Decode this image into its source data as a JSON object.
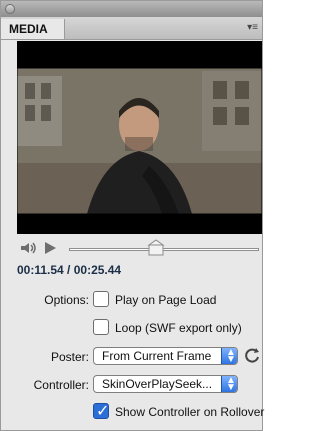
{
  "panel": {
    "tab_label": "MEDIA",
    "menu_icon": "panel-menu-icon"
  },
  "playback": {
    "current_time": "00:11.54",
    "separator": " / ",
    "duration": "00:25.44",
    "progress_fraction": 0.45,
    "icons": {
      "volume": "speaker-icon",
      "play": "play-icon",
      "refresh": "refresh-icon"
    }
  },
  "options": {
    "label": "Options:",
    "play_on_load": {
      "label": "Play on Page Load",
      "checked": false
    },
    "loop": {
      "label": "Loop (SWF export only)",
      "checked": false
    }
  },
  "poster": {
    "label": "Poster:",
    "value": "From Current Frame"
  },
  "controller": {
    "label": "Controller:",
    "value": "SkinOverPlaySeek...",
    "show_on_rollover": {
      "label": "Show Controller on Rollover",
      "checked": true
    }
  },
  "colors": {
    "accent": "#2b6fd6",
    "timecode": "#1b2f47"
  }
}
